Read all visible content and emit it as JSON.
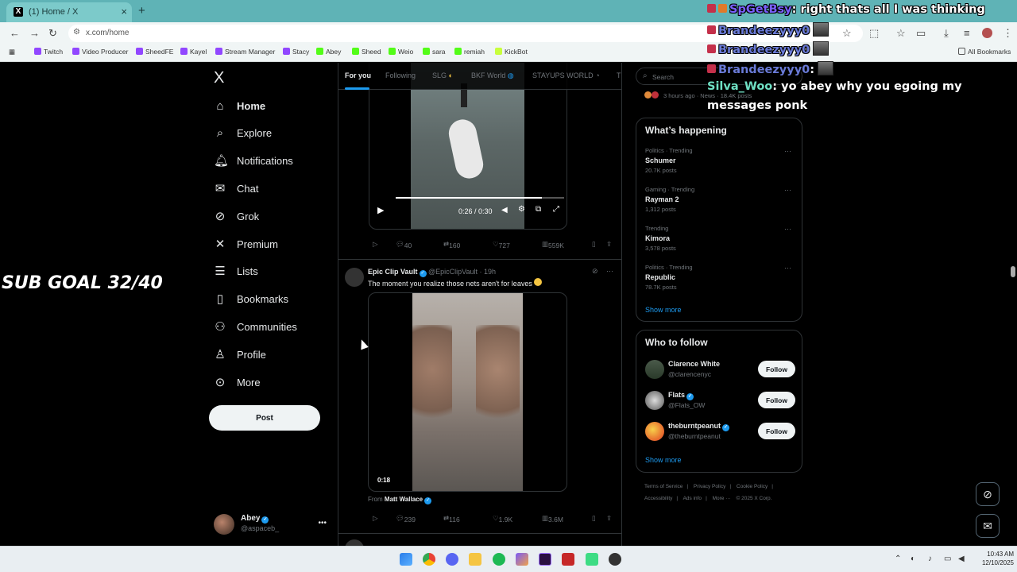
{
  "browser": {
    "tab_title": "(1) Home / X",
    "tab_close": "×",
    "new_tab": "+",
    "url": "x.com/home",
    "bookmarks": [
      "Twitch",
      "Video Producer",
      "SheedFE",
      "Kayel",
      "Stream Manager",
      "Stacy",
      "Abey",
      "Sheed",
      "Weio",
      "sara",
      "remiah",
      "KickBot"
    ],
    "all_bookmarks": "All Bookmarks"
  },
  "nav": {
    "logo": "X",
    "items": [
      {
        "label": "Home",
        "icon": "home-icon"
      },
      {
        "label": "Explore",
        "icon": "search-icon"
      },
      {
        "label": "Notifications",
        "icon": "bell-icon"
      },
      {
        "label": "Chat",
        "icon": "mail-icon"
      },
      {
        "label": "Grok",
        "icon": "grok-icon"
      },
      {
        "label": "Premium",
        "icon": "x-icon"
      },
      {
        "label": "Lists",
        "icon": "list-icon"
      },
      {
        "label": "Bookmarks",
        "icon": "bookmark-icon"
      },
      {
        "label": "Communities",
        "icon": "people-icon"
      },
      {
        "label": "Profile",
        "icon": "person-icon"
      },
      {
        "label": "More",
        "icon": "more-icon"
      }
    ],
    "post_label": "Post",
    "account_name": "Abey",
    "account_handle": "@aspaceb_",
    "account_dots": "•••"
  },
  "timeline": {
    "tabs": [
      "For you",
      "Following",
      "SLG",
      "BKF World",
      "STAYUPS WORLD",
      "T"
    ],
    "post1": {
      "video_time": "0:26 / 0:30",
      "progress": 0.87,
      "replies": "40",
      "reposts": "160",
      "likes": "727",
      "views": "559K"
    },
    "post2": {
      "author": "Epic Clip Vault",
      "handle": "@EpicClipVault",
      "time": "· 19h",
      "text": "The moment you realize those nets aren't for leaves",
      "video_duration": "0:18",
      "from_label": "From",
      "from_name": "Matt Wallace",
      "replies": "239",
      "reposts": "116",
      "likes": "1.9K",
      "views": "3.6M"
    }
  },
  "right": {
    "search_placeholder": "Search",
    "news_meta": "3 hours ago · News · 18.4K posts",
    "whats_happening": "What’s happening",
    "trends": [
      {
        "context": "Politics · Trending",
        "name": "Schumer",
        "count": "20.7K posts"
      },
      {
        "context": "Gaming · Trending",
        "name": "Rayman 2",
        "count": "1,312 posts"
      },
      {
        "context": "Trending",
        "name": "Kimora",
        "count": "3,578 posts"
      },
      {
        "context": "Politics · Trending",
        "name": "Republic",
        "count": "78.7K posts"
      }
    ],
    "show_more": "Show more",
    "who_to_follow": "Who to follow",
    "follow": [
      {
        "name": "Clarence White",
        "handle": "@clarencenyc",
        "verified": false
      },
      {
        "name": "Flats",
        "handle": "@Flats_OW",
        "verified": true
      },
      {
        "name": "theburntpeanut",
        "handle": "@theburntpeanut",
        "verified": true
      }
    ],
    "follow_label": "Follow",
    "footer": [
      "Terms of Service",
      "|",
      "Privacy Policy",
      "|",
      "Cookie Policy",
      "|",
      "Accessibility",
      "|",
      "Ads info",
      "|",
      "More ···",
      "© 2025 X Corp."
    ]
  },
  "overlay": {
    "sub_goal": "SUB GOAL 32/40",
    "chat": [
      {
        "user": "SpGetBsy",
        "color": "#7b61ff",
        "text": ": right thats all I was thinking"
      },
      {
        "user": "Brandeezyyy0",
        "color": "#6a7bd8",
        "text": ""
      },
      {
        "user": "Brandeezyyy0",
        "color": "#6a7bd8",
        "text": ""
      },
      {
        "user": "Brandeezyyy0",
        "color": "#6a7bd8",
        "text": ":"
      },
      {
        "user": "Silva_Woo",
        "color": "#6fe0c4",
        "text": ": yo abey why you egoing my"
      },
      {
        "user": "",
        "color": "#ffffff",
        "text": "messages ponk"
      }
    ]
  },
  "taskbar": {
    "time": "10:43 AM",
    "date": "12/10/2025"
  }
}
